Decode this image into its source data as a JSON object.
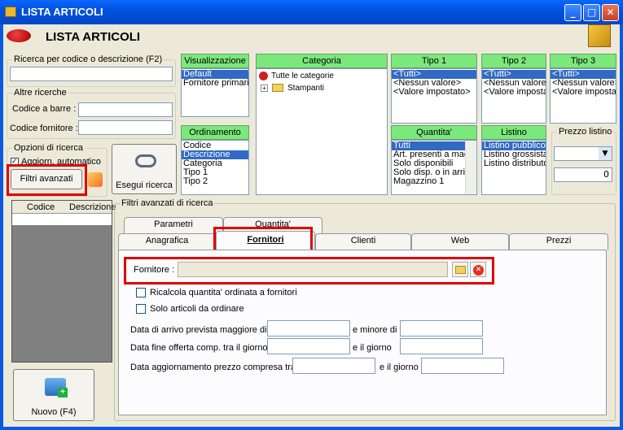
{
  "window": {
    "title": "LISTA ARTICOLI",
    "header": "LISTA ARTICOLI"
  },
  "search": {
    "codice_legend": "Ricerca per codice o descrizione (F2)",
    "altre_legend": "Altre ricerche",
    "barcode_label": "Codice a barre :",
    "fornitore_code_label": "Codice fornitore :",
    "opzioni_legend": "Opzioni di ricerca",
    "auto_label": "Aggiorn. automatico",
    "filtri_button": "Filtri avanzati",
    "esegui_button": "Esegui ricerca"
  },
  "visualizzazione": {
    "header": "Visualizzazione",
    "items": [
      "Default",
      "Fornitore primario"
    ]
  },
  "ordinamento": {
    "header": "Ordinamento",
    "items": [
      "Codice",
      "Descrizione",
      "Categoria",
      "Tipo 1",
      "Tipo 2"
    ]
  },
  "categoria": {
    "header": "Categoria",
    "root": "Tutte le categorie",
    "child": "Stampanti"
  },
  "tipo1": {
    "header": "Tipo 1",
    "items": [
      "<Tutti>",
      "<Nessun valore>",
      "<Valore impostato>"
    ]
  },
  "tipo2": {
    "header": "Tipo 2",
    "items": [
      "<Tutti>",
      "<Nessun valore>",
      "<Valore impostat"
    ]
  },
  "tipo3": {
    "header": "Tipo 3",
    "items": [
      "<Tutti>",
      "<Nessun valore>",
      "<Valore impostat"
    ]
  },
  "quantita": {
    "header": "Quantita'",
    "items": [
      "Tutti",
      "Art. presenti a magaz",
      "Solo disponibili",
      "Solo disp. o in arrivo",
      "Magazzino 1"
    ]
  },
  "listino": {
    "header": "Listino",
    "items": [
      "Listino pubblico",
      "Listino grossista",
      "Listino distributore"
    ]
  },
  "prezzo": {
    "legend": "Prezzo listino",
    "value": "0"
  },
  "grid": {
    "columns": [
      "Codice",
      "Descrizione"
    ]
  },
  "nuovo_button": "Nuovo (F4)",
  "filtri": {
    "legend": "Filtri avanzati di ricerca",
    "tabs_back": [
      "Parametri",
      "Quantita'"
    ],
    "tabs_front": [
      "Anagrafica",
      "Fornitori",
      "Clienti",
      "Web",
      "Prezzi"
    ],
    "fornitore_label": "Fornitore :",
    "ricalcola_label": "Ricalcola quantita' ordinata a fornitori",
    "solo_label": "Solo articoli da ordinare",
    "arrivo_label": "Data di arrivo prevista maggiore di",
    "minore_label": "e minore di",
    "fine_label": "Data fine offerta comp. tra il giorno",
    "egiorno_label1": "e il giorno",
    "aggiorn_label": "Data aggiornamento prezzo compresa tra",
    "egiorno_label2": "e il giorno"
  }
}
